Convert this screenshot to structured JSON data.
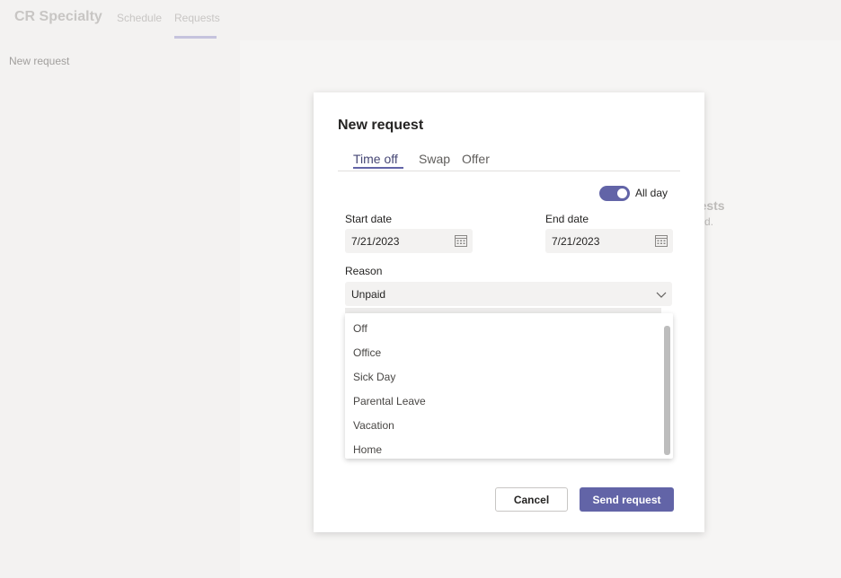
{
  "app": {
    "title": "CR Specialty"
  },
  "nav": {
    "tabs": [
      "Schedule",
      "Requests"
    ],
    "active": "Requests"
  },
  "left_panel": {
    "new_request_label": "New request"
  },
  "background": {
    "heading_fragment": "uests",
    "sub_fragment": "rted."
  },
  "dialog": {
    "title": "New request",
    "tabs": [
      "Time off",
      "Swap",
      "Offer"
    ],
    "active_tab": "Time off",
    "all_day": {
      "label": "All day",
      "enabled": true
    },
    "start_date": {
      "label": "Start date",
      "value": "7/21/2023",
      "icon": "calendar-icon"
    },
    "end_date": {
      "label": "End date",
      "value": "7/21/2023",
      "icon": "calendar-icon"
    },
    "reason": {
      "label": "Reason",
      "value": "Unpaid",
      "icon": "chevron-down-icon",
      "options": [
        "Off",
        "Office",
        "Sick Day",
        "Parental Leave",
        "Vacation",
        "Home"
      ]
    },
    "buttons": {
      "cancel": "Cancel",
      "send": "Send request"
    }
  },
  "colors": {
    "accent": "#6264a7",
    "page_background": "#f3f2f1",
    "dialog_background": "#ffffff",
    "input_background": "#f3f2f1"
  }
}
